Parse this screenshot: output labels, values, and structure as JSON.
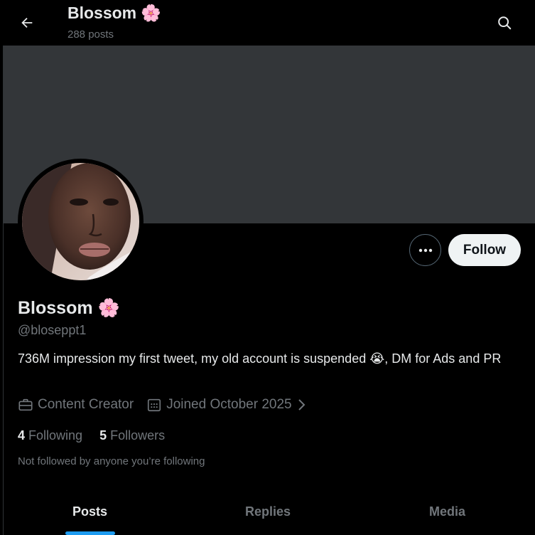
{
  "header": {
    "title": "Blossom",
    "emoji": "🌸",
    "posts_count": "288 posts",
    "back_icon": "arrow-left-icon",
    "search_icon": "search-icon"
  },
  "profile": {
    "name": "Blossom",
    "name_emoji": "🌸",
    "handle": "@bloseppt1",
    "bio_part1": "736M impression my first tweet, my old account is suspended ",
    "bio_emoji": "😭",
    "bio_part2": ", DM for Ads and PR",
    "category": "Content Creator",
    "joined": "Joined October 2025",
    "following_count": "4",
    "following_label": "Following",
    "followers_count": "5",
    "followers_label": "Followers",
    "followed_by_note": "Not followed by anyone you’re following"
  },
  "actions": {
    "follow_label": "Follow",
    "more_icon": "more-icon"
  },
  "tabs": [
    {
      "label": "Posts",
      "active": true
    },
    {
      "label": "Replies",
      "active": false
    },
    {
      "label": "Media",
      "active": false
    }
  ],
  "colors": {
    "background": "#000000",
    "banner": "#333639",
    "accent": "#1d9bf0",
    "muted_text": "#71767b",
    "primary_text": "#e7e9ea"
  }
}
